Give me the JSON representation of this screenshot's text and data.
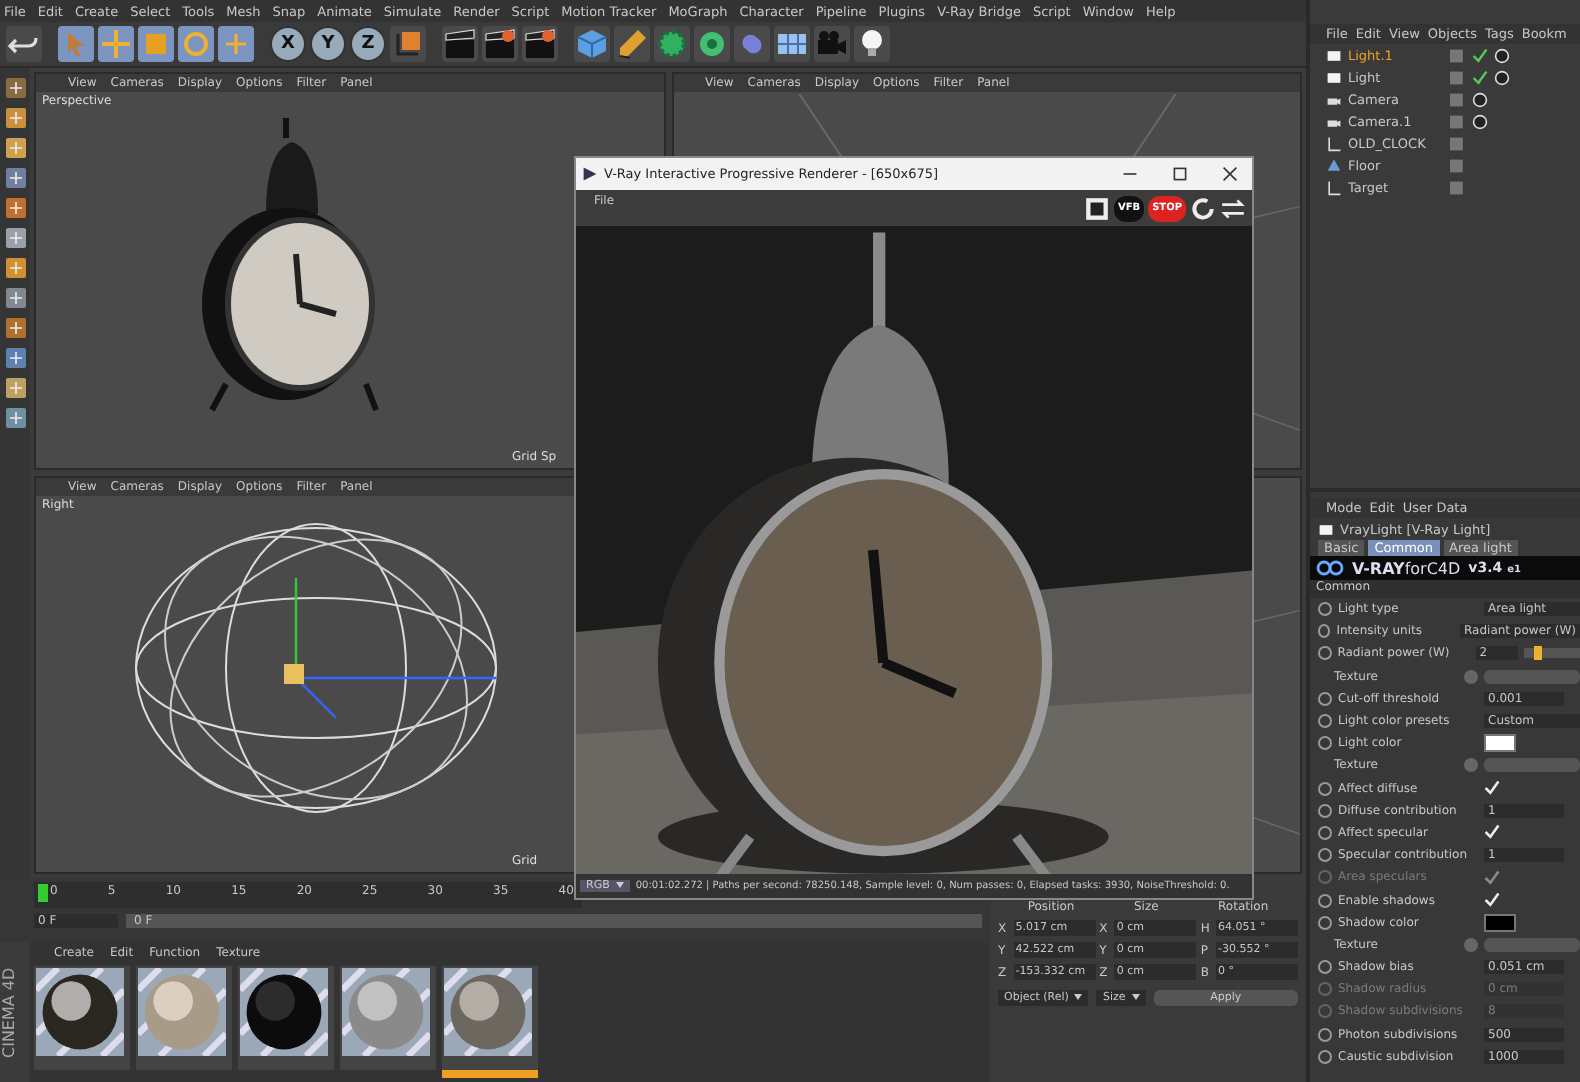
{
  "menu_bar": [
    "File",
    "Edit",
    "Create",
    "Select",
    "Tools",
    "Mesh",
    "Snap",
    "Animate",
    "Simulate",
    "Render",
    "Script",
    "Motion Tracker",
    "MoGraph",
    "Character",
    "Pipeline",
    "Plugins",
    "V-Ray Bridge",
    "Script",
    "Window",
    "Help"
  ],
  "axis_buttons": [
    "X",
    "Y",
    "Z"
  ],
  "viewports": [
    {
      "menu": [
        "View",
        "Cameras",
        "Display",
        "Options",
        "Filter",
        "Panel"
      ],
      "label": "Perspective",
      "footer": "Grid Sp",
      "kind": "clock"
    },
    {
      "menu": [
        "View",
        "Cameras",
        "Display",
        "Options",
        "Filter",
        "Panel"
      ],
      "kind": "grid"
    },
    {
      "menu": [
        "View",
        "Cameras",
        "Display",
        "Options",
        "Filter",
        "Panel"
      ],
      "label": "Right",
      "footer": "Grid",
      "kind": "light"
    },
    {
      "kind": "grid"
    }
  ],
  "render_window": {
    "title": "V-Ray Interactive Progressive Renderer - [650x675]",
    "menu": [
      "File"
    ],
    "toolbar": [
      "VFB",
      "STOP"
    ],
    "channel": "RGB",
    "status": "00:01:02.272 | Paths per second: 78250.148, Sample level: 0, Num passes: 0, Elapsed tasks: 3930, NoiseThreshold: 0."
  },
  "object_manager": {
    "menu": [
      "File",
      "Edit",
      "View",
      "Objects",
      "Tags",
      "Bookm"
    ],
    "objects": [
      {
        "name": "Light.1",
        "kind": "light",
        "selected": true
      },
      {
        "name": "Light",
        "kind": "light",
        "selected": false
      },
      {
        "name": "Camera",
        "kind": "camera",
        "selected": false
      },
      {
        "name": "Camera.1",
        "kind": "camera",
        "selected": false
      },
      {
        "name": "OLD_CLOCK",
        "kind": "null",
        "selected": false
      },
      {
        "name": "Floor",
        "kind": "floor",
        "selected": false
      },
      {
        "name": "Target",
        "kind": "null",
        "selected": false
      }
    ]
  },
  "attribute_manager": {
    "menu": [
      "Mode",
      "Edit",
      "User Data"
    ],
    "object": "VrayLight [V-Ray Light]",
    "tabs": [
      {
        "label": "Basic",
        "selected": false
      },
      {
        "label": "Common",
        "selected": true
      },
      {
        "label": "Area light",
        "selected": false
      }
    ],
    "banner": {
      "brand": "V-RAY",
      "suffix": "forC4D",
      "version": "v3.4",
      "edition": "e1"
    },
    "section": "Common",
    "rows": [
      {
        "kind": "dropdown",
        "label": "Light type",
        "value": "Area light",
        "disabled": false
      },
      {
        "kind": "dropdown",
        "label": "Intensity units",
        "value": "Radiant power (W)",
        "disabled": false
      },
      {
        "kind": "slider",
        "label": "Radiant power (W)",
        "value": "2",
        "level": 0.2,
        "disabled": false
      },
      {
        "kind": "texture",
        "label": "Texture",
        "disabled": false
      },
      {
        "kind": "number",
        "label": "Cut-off threshold",
        "value": "0.001",
        "disabled": false
      },
      {
        "kind": "dropdown",
        "label": "Light color presets",
        "value": "Custom",
        "disabled": false
      },
      {
        "kind": "color",
        "label": "Light color",
        "color": "#ffffff",
        "disabled": false
      },
      {
        "kind": "texture",
        "label": "Texture",
        "disabled": false
      },
      {
        "kind": "checkbox",
        "label": "Affect diffuse",
        "checked": true,
        "disabled": false
      },
      {
        "kind": "number",
        "label": "Diffuse contribution",
        "value": "1",
        "disabled": false
      },
      {
        "kind": "checkbox",
        "label": "Affect specular",
        "checked": true,
        "disabled": false
      },
      {
        "kind": "number",
        "label": "Specular contribution",
        "value": "1",
        "disabled": false
      },
      {
        "kind": "checkbox",
        "label": "Area speculars",
        "checked": true,
        "disabled": true
      },
      {
        "kind": "checkbox",
        "label": "Enable shadows",
        "checked": true,
        "disabled": false
      },
      {
        "kind": "color",
        "label": "Shadow color",
        "color": "#000000",
        "disabled": false
      },
      {
        "kind": "texture",
        "label": "Texture",
        "disabled": false
      },
      {
        "kind": "number",
        "label": "Shadow bias",
        "value": "0.051 cm",
        "disabled": false
      },
      {
        "kind": "number",
        "label": "Shadow radius",
        "value": "0 cm",
        "disabled": true
      },
      {
        "kind": "number",
        "label": "Shadow subdivisions",
        "value": "8",
        "disabled": true
      },
      {
        "kind": "number",
        "label": "Photon subdivisions",
        "value": "500",
        "disabled": false
      },
      {
        "kind": "number",
        "label": "Caustic subdivision",
        "value": "1000",
        "disabled": false
      }
    ]
  },
  "timeline": {
    "ticks": [
      "0",
      "5",
      "10",
      "15",
      "20",
      "25",
      "30",
      "35",
      "40"
    ],
    "current_frame": "0 F",
    "start_frame": "0 F"
  },
  "material_manager": {
    "menu": [
      "Create",
      "Edit",
      "Function",
      "Texture"
    ],
    "materials": [
      {
        "kind": "picture",
        "selected": false
      },
      {
        "kind": "picture",
        "selected": false
      },
      {
        "kind": "picture",
        "selected": false
      },
      {
        "kind": "picture",
        "selected": false
      },
      {
        "kind": "picture",
        "selected": true
      }
    ]
  },
  "coordinates": {
    "columns": [
      "Position",
      "Size",
      "Rotation"
    ],
    "rows": [
      [
        {
          "axis": "X",
          "value": "5.017 cm"
        },
        {
          "axis": "X",
          "value": "0 cm"
        },
        {
          "axis": "H",
          "value": "64.051 °"
        }
      ],
      [
        {
          "axis": "Y",
          "value": "42.522 cm"
        },
        {
          "axis": "Y",
          "value": "0 cm"
        },
        {
          "axis": "P",
          "value": "-30.552 °"
        }
      ],
      [
        {
          "axis": "Z",
          "value": "-153.332 cm"
        },
        {
          "axis": "Z",
          "value": "0 cm"
        },
        {
          "axis": "B",
          "value": "0 °"
        }
      ]
    ],
    "modes": [
      "Object (Rel)",
      "Size"
    ],
    "apply": "Apply"
  },
  "brand": "CINEMA 4D"
}
